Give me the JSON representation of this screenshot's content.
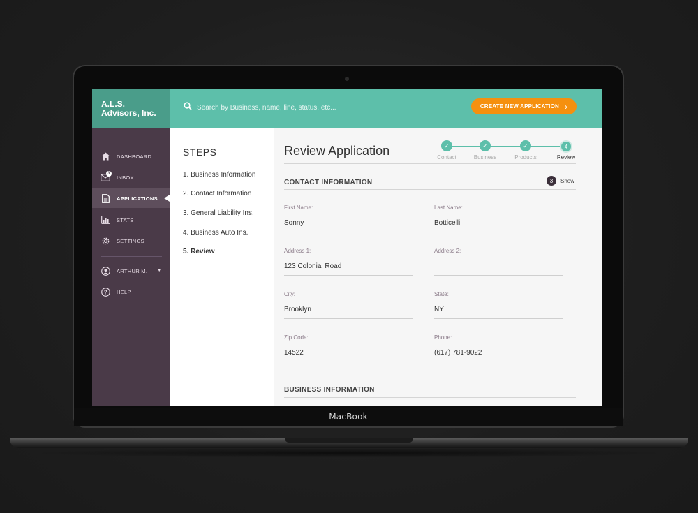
{
  "device": {
    "label": "MacBook"
  },
  "brand": {
    "line1": "A.L.S.",
    "line2": "Advisors, Inc."
  },
  "search": {
    "placeholder": "Search by Business, name, line, status, etc..."
  },
  "cta": {
    "label": "CREATE NEW APPLICATION"
  },
  "sidebar": {
    "items": [
      {
        "label": "DASHBOARD",
        "icon": "home-icon"
      },
      {
        "label": "INBOX",
        "icon": "mail-icon",
        "badge": "3"
      },
      {
        "label": "APPLICATIONS",
        "icon": "document-icon",
        "active": true
      },
      {
        "label": "STATS",
        "icon": "bar-chart-icon"
      },
      {
        "label": "SETTINGS",
        "icon": "gear-icon"
      }
    ],
    "user": {
      "label": "ARTHUR M.",
      "icon": "user-icon"
    },
    "help": {
      "label": "HELP",
      "icon": "help-icon"
    }
  },
  "steps": {
    "title": "STEPS",
    "items": [
      "1. Business Information",
      "2. Contact Information",
      "3. General Liability Ins.",
      "4. Business Auto Ins.",
      "5. Review"
    ],
    "current": 5
  },
  "main": {
    "title": "Review Application",
    "progress": {
      "steps": [
        "Contact",
        "Business",
        "Products",
        "Review"
      ],
      "current_number": "4"
    },
    "contact": {
      "heading": "CONTACT INFORMATION",
      "show_count": "3",
      "show_label": "Show",
      "fields": {
        "first_name": {
          "label": "First Name:",
          "value": "Sonny"
        },
        "last_name": {
          "label": "Last Name:",
          "value": "Botticelli"
        },
        "address1": {
          "label": "Address 1:",
          "value": "123 Colonial Road"
        },
        "address2": {
          "label": "Address 2:",
          "value": ""
        },
        "city": {
          "label": "City:",
          "value": "Brooklyn"
        },
        "state": {
          "label": "State:",
          "value": "NY"
        },
        "zip": {
          "label": "Zip Code:",
          "value": "14522"
        },
        "phone": {
          "label": "Phone:",
          "value": "(617) 781-9022"
        }
      }
    },
    "business": {
      "heading": "BUSINESS INFORMATION"
    }
  },
  "colors": {
    "teal": "#5dbfaa",
    "teal_dark": "#4a9d8a",
    "plum": "#4a3a48",
    "orange": "#f5900f"
  }
}
